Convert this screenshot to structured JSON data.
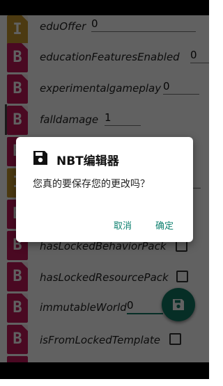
{
  "list": {
    "items": [
      {
        "type_letter": "I",
        "name": "eduOffer",
        "value": "0",
        "kind": "int"
      },
      {
        "type_letter": "B",
        "name": "educationFeaturesEnabled",
        "value": "0",
        "kind": "byte"
      },
      {
        "type_letter": "B",
        "name": "experimentalgameplay",
        "value": "0",
        "kind": "byte"
      },
      {
        "type_letter": "B",
        "name": "falldamage",
        "value": "1",
        "kind": "byte"
      },
      {
        "type_letter": "B",
        "name": "hasLockedBehaviorPack",
        "kind": "byte-check"
      },
      {
        "type_letter": "B",
        "name": "hasLockedResourcePack",
        "kind": "byte-check"
      },
      {
        "type_letter": "B",
        "name": "immutableWorld",
        "value": "0",
        "kind": "byte"
      },
      {
        "type_letter": "B",
        "name": "isFromLockedTemplate",
        "kind": "byte-check"
      }
    ]
  },
  "dialog": {
    "title": "NBT编辑器",
    "message": "您真的要保存您的更改吗？",
    "cancel_label": "取消",
    "ok_label": "确定"
  },
  "colors": {
    "accent": "#107a64",
    "int_tag": "#c99a2e",
    "byte_tag": "#c2185b"
  },
  "icons": {
    "fab": "save-icon",
    "dialog": "save-icon"
  }
}
